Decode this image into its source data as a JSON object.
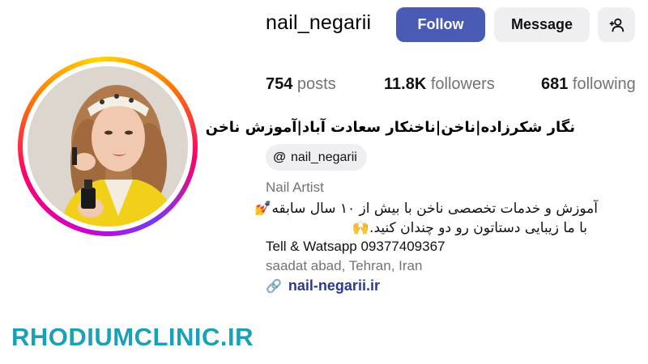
{
  "profile": {
    "username": "nail_negarii",
    "follow_label": "Follow",
    "message_label": "Message",
    "add_user_glyph": "+⚇",
    "full_name": "نگار شکرزاده|ناخن|ناخنکار سعادت آباد|آموزش ناخن"
  },
  "stats": {
    "posts_count": "754",
    "posts_label": " posts",
    "followers_count": "11.8K",
    "followers_label": " followers",
    "following_count": "681",
    "following_label": " following"
  },
  "threads": {
    "icon_glyph": "@",
    "handle": "nail_negarii"
  },
  "bio": {
    "category": "Nail Artist",
    "line1": "آموزش و خدمات تخصصی ناخن با بیش از ۱۰ سال سابقه",
    "line1_emoji": "💅",
    "line2": "با ما زیبایی دستاتون رو دو چندان کنید.",
    "line2_emoji": "🙌",
    "contact": "Tell & Watsapp 09377409367",
    "location": "saadat abad, Tehran, Iran",
    "link_glyph": "🔗",
    "link": "nail-negarii.ir"
  },
  "watermark": "RHODIUMCLINIC.IR",
  "colors": {
    "follow_button": "#4a5bb5",
    "secondary_button": "#efeff1",
    "link": "#2a3b8f",
    "watermark": "#1ba1b5",
    "muted_text": "#737373"
  },
  "icons": {
    "avatar_ring": "story-gradient-ring",
    "threads": "threads-icon",
    "link": "link-icon",
    "add_user": "add-user-icon"
  }
}
